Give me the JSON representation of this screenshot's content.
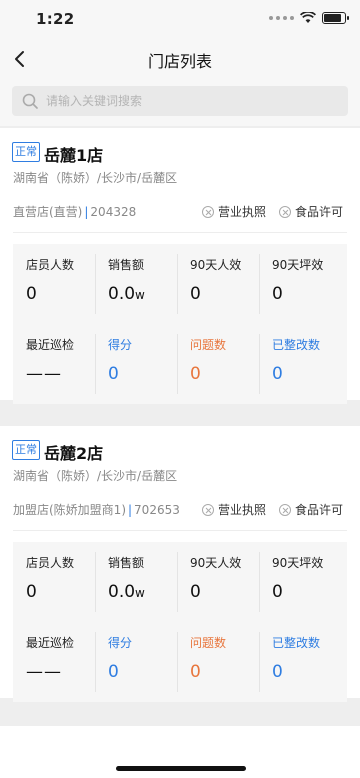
{
  "status_bar": {
    "time": "1:22"
  },
  "nav": {
    "title": "门店列表"
  },
  "search": {
    "placeholder": "请输入关键词搜索"
  },
  "stores": [
    {
      "status": "正常",
      "name": "岳麓1店",
      "address": "湖南省（陈娇）/长沙市/岳麓区",
      "type": "直营店(直营)",
      "code": "204328",
      "licenses": [
        "营业执照",
        "食品许可"
      ],
      "stats": [
        {
          "label": "店员人数",
          "value": "0"
        },
        {
          "label": "销售额",
          "value": "0.0",
          "unit": "w"
        },
        {
          "label": "90天人效",
          "value": "0"
        },
        {
          "label": "90天坪效",
          "value": "0"
        },
        {
          "label": "最近巡检",
          "value": "——"
        },
        {
          "label": "得分",
          "value": "0"
        },
        {
          "label": "问题数",
          "value": "0"
        },
        {
          "label": "已整改数",
          "value": "0"
        }
      ]
    },
    {
      "status": "正常",
      "name": "岳麓2店",
      "address": "湖南省（陈娇）/长沙市/岳麓区",
      "type": "加盟店(陈娇加盟商1)",
      "code": "702653",
      "licenses": [
        "营业执照",
        "食品许可"
      ],
      "stats": [
        {
          "label": "店员人数",
          "value": "0"
        },
        {
          "label": "销售额",
          "value": "0.0",
          "unit": "w"
        },
        {
          "label": "90天人效",
          "value": "0"
        },
        {
          "label": "90天坪效",
          "value": "0"
        },
        {
          "label": "最近巡检",
          "value": "——"
        },
        {
          "label": "得分",
          "value": "0"
        },
        {
          "label": "问题数",
          "value": "0"
        },
        {
          "label": "已整改数",
          "value": "0"
        }
      ]
    }
  ],
  "colors": {
    "accent": "#2f7de1",
    "warning": "#e8763d",
    "background": "#eeeeee"
  }
}
